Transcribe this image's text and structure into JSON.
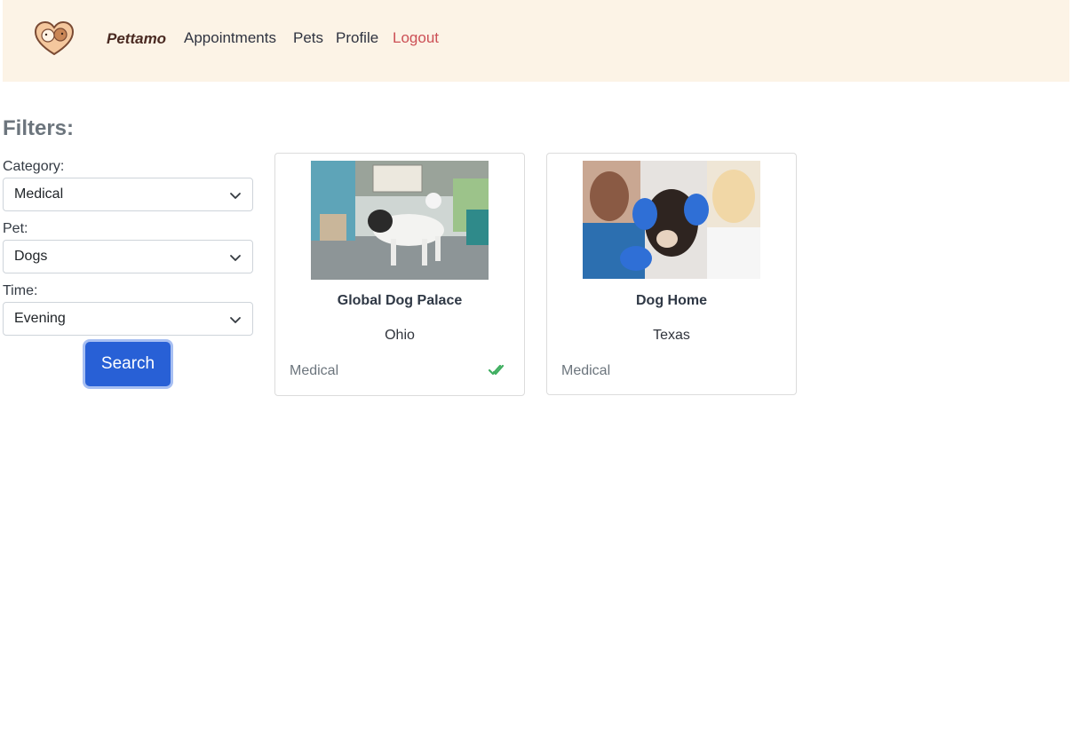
{
  "navbar": {
    "brand": "Pettamo",
    "links": [
      "Appointments",
      "Pets",
      "Profile"
    ],
    "logout": "Logout",
    "accent": "#cc4f55"
  },
  "filters": {
    "title": "Filters:",
    "category_label": "Category:",
    "category_value": "Medical",
    "pet_label": "Pet:",
    "pet_value": "Dogs",
    "time_label": "Time:",
    "time_value": "Evening",
    "search_label": "Search"
  },
  "cards": [
    {
      "title": "Global Dog Palace",
      "location": "Ohio",
      "category": "Medical",
      "verified": true,
      "icon": "double-check-icon"
    },
    {
      "title": "Dog Home",
      "location": "Texas",
      "category": "Medical",
      "verified": false
    }
  ],
  "colors": {
    "navbar_bg": "#fcf3e6",
    "button": "#2860d6",
    "verified": "#3fae60"
  }
}
